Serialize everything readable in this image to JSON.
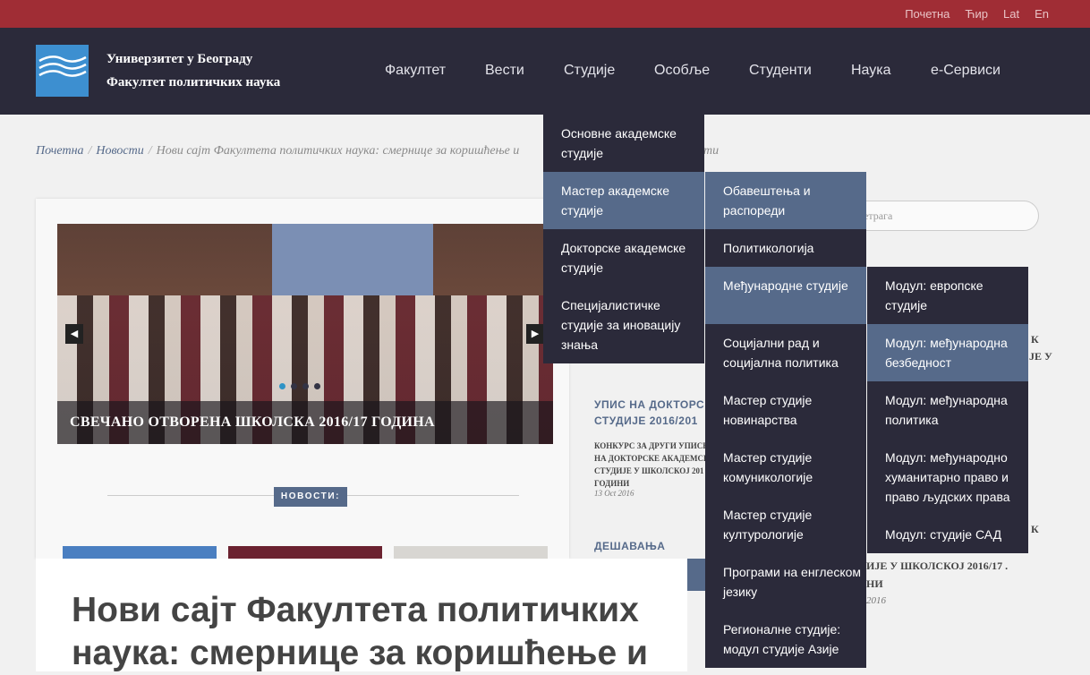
{
  "topbar": {
    "links": [
      "Почетна",
      "Ћир",
      "Lat",
      "En"
    ]
  },
  "brand": {
    "line1": "Универзитет у Београду",
    "line2": "Факултет политичких наука"
  },
  "nav": {
    "items": [
      "Факултет",
      "Вести",
      "Студије",
      "Особље",
      "Студенти",
      "Наука",
      "е-Сервиси"
    ]
  },
  "breadcrumb": {
    "home": "Почетна",
    "news": "Новости",
    "current": "Нови сајт Факултета политичких наука: смернице за коришћење и",
    "tail": "ти"
  },
  "slider": {
    "caption": "СВЕЧАНО ОТВОРЕНА ШКОЛСКА 2016/17 ГОДИНА",
    "prev_icon": "chevron-left-icon",
    "next_icon": "chevron-right-icon"
  },
  "novosti_label": "НОВОСТИ:",
  "article": {
    "title": "Нови сајт Факултета политичких наука: смернице за коришћење и"
  },
  "sidebar": {
    "search_placeholder": "ретрага",
    "block1": {
      "heading1": "УПИС НА ДОКТОРС",
      "heading2": "СТУДИЈЕ 2016/201",
      "p1": "КОНКУРС ЗА ДРУГИ УПИСН",
      "p2": "НА ДОКТОРСКЕ АКАДЕМСК",
      "p3": "СТУДИЈЕ У ШКОЛСКОЈ 201",
      "p4": "ГОДИНИ",
      "date": "13 Oct 2016"
    },
    "block2": {
      "heading": "ДЕШАВАЊА"
    },
    "frag_k1": "К",
    "frag_je_u": "ЈЕ У",
    "frag_k2": "К",
    "frag_line1": "ИЈЕ У ШКОЛСКОЈ 2016/17 .",
    "frag_line2": "НИ",
    "frag_date": "2016"
  },
  "menus": {
    "level1": [
      "Основне академске студије",
      "Мастер академске студије",
      "Докторске академске студије",
      "Специјалистичке студије за иновацију знања"
    ],
    "level2": [
      "Обавештења и распореди",
      "Политикологија",
      "Међународне студије",
      "Социјални рад и социјална политика",
      "Мастер студије новинарства",
      "Мастер студије комуникологије",
      "Мастер студије културологије",
      "Програми на енглеском језику",
      "Регионалне студије: модул студије Азије"
    ],
    "level3": [
      "Модул: европске студије",
      "Модул: међународна безбедност",
      "Модул: међународна политика",
      "Модул: међународно хуманитарно право и право људских права",
      "Модул: студије САД"
    ]
  }
}
